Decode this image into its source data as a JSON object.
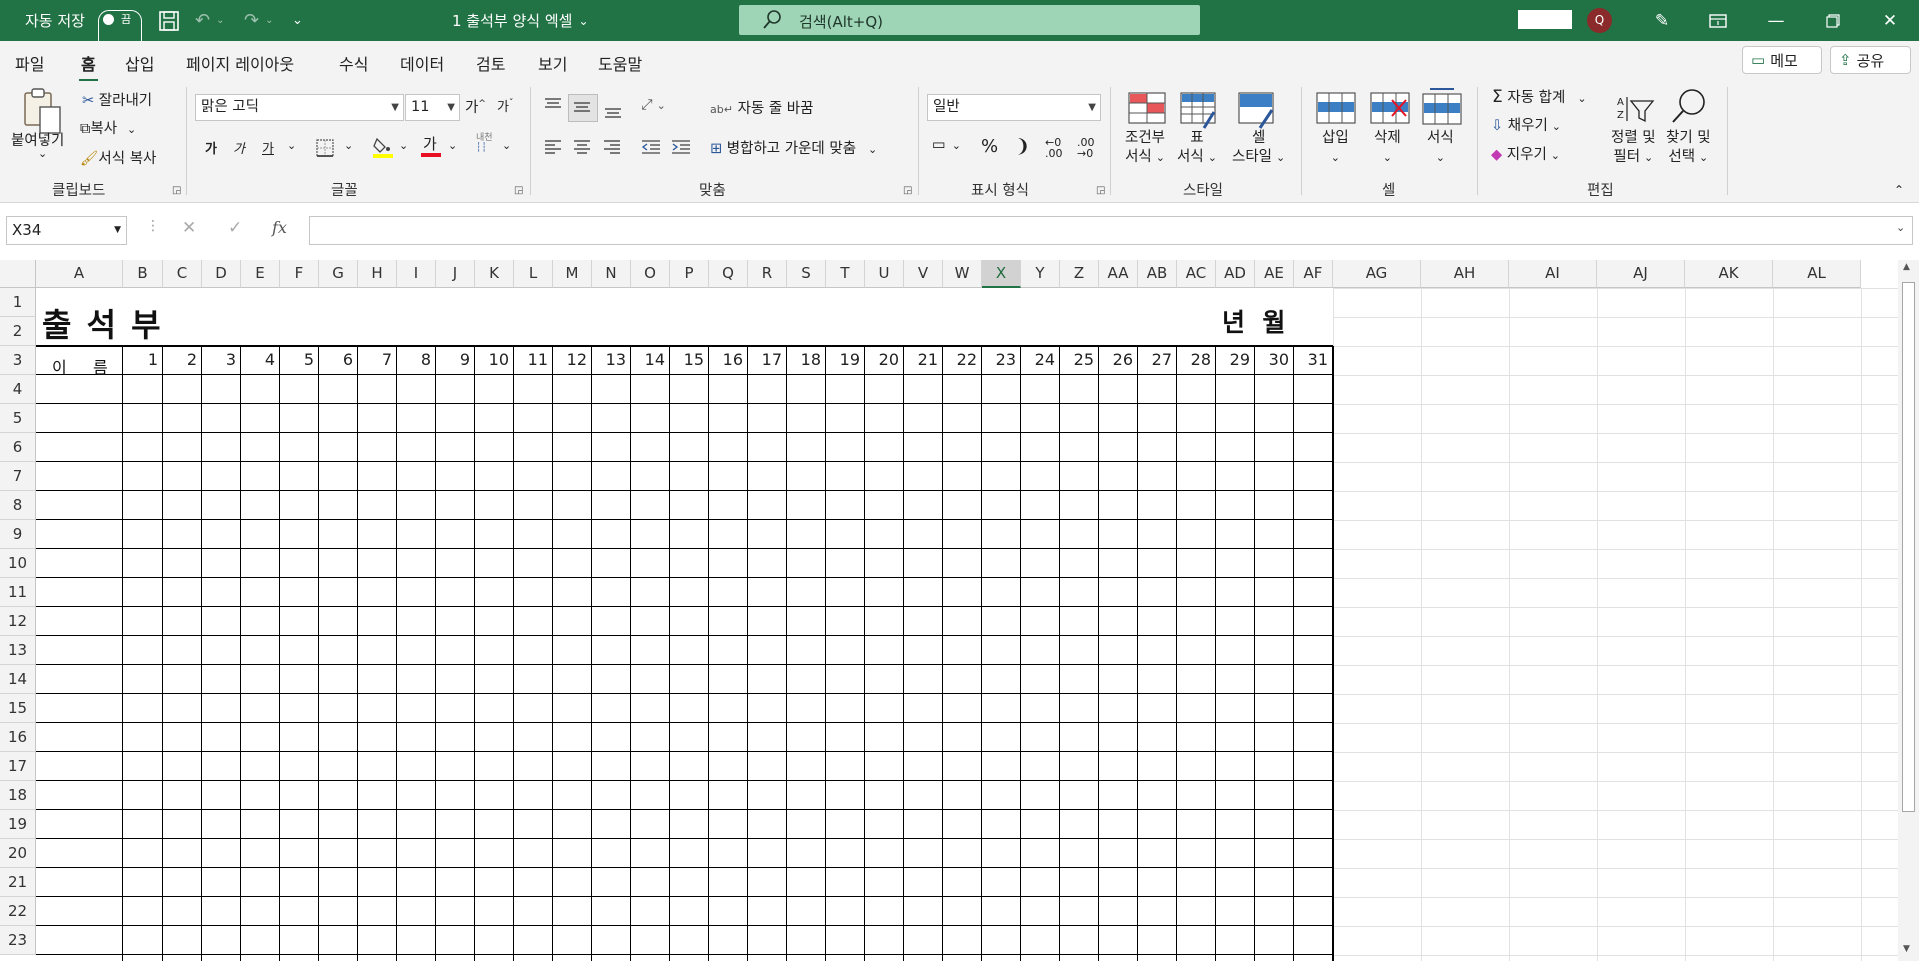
{
  "titlebar": {
    "autosave_label": "자동 저장",
    "autosave_state": "끔",
    "doc_title": "1 출석부 양식 엑셀",
    "search_placeholder": "검색(Alt+Q)",
    "avatar_initial": "Q"
  },
  "menu": {
    "tabs": [
      "파일",
      "홈",
      "삽입",
      "페이지 레이아웃",
      "수식",
      "데이터",
      "검토",
      "보기",
      "도움말"
    ],
    "active": "홈",
    "memo": "메모",
    "share": "공유"
  },
  "ribbon": {
    "clipboard": {
      "paste": "붙여넣기",
      "cut": "잘라내기",
      "copy": "복사",
      "format_painter": "서식 복사",
      "group": "클립보드"
    },
    "font": {
      "name": "맑은 고딕",
      "size": "11",
      "bold": "가",
      "italic": "가",
      "underline": "가",
      "group": "글꼴",
      "increase": "가",
      "decrease": "가",
      "phonetic": "내천"
    },
    "alignment": {
      "wrap": "자동 줄 바꿈",
      "merge": "병합하고 가운데 맞춤",
      "group": "맞춤"
    },
    "number": {
      "format": "일반",
      "group": "표시 형식"
    },
    "styles": {
      "conditional_1": "조건부",
      "conditional_2": "서식",
      "table_1": "표",
      "table_2": "서식",
      "cell_1": "셀",
      "cell_2": "스타일",
      "group": "스타일"
    },
    "cells": {
      "insert": "삽입",
      "delete": "삭제",
      "format": "서식",
      "group": "셀"
    },
    "editing": {
      "autosum": "자동 합계",
      "fill": "채우기",
      "clear": "지우기",
      "sort_1": "정렬 및",
      "sort_2": "필터",
      "find_1": "찾기 및",
      "find_2": "선택",
      "group": "편집"
    }
  },
  "formula_bar": {
    "name_box": "X34",
    "fx": "fx",
    "value": ""
  },
  "sheet": {
    "columns": [
      "A",
      "B",
      "C",
      "D",
      "E",
      "F",
      "G",
      "H",
      "I",
      "J",
      "K",
      "L",
      "M",
      "N",
      "O",
      "P",
      "Q",
      "R",
      "S",
      "T",
      "U",
      "V",
      "W",
      "X",
      "Y",
      "Z",
      "AA",
      "AB",
      "AC",
      "AD",
      "AE",
      "AF",
      "AG",
      "AH",
      "AI",
      "AJ",
      "AK",
      "AL"
    ],
    "selected_column": "X",
    "rows": [
      "1",
      "2",
      "3",
      "4",
      "5",
      "6",
      "7",
      "8",
      "9",
      "10",
      "11",
      "12",
      "13",
      "14",
      "15",
      "16",
      "17",
      "18",
      "19",
      "20",
      "21",
      "22",
      "23"
    ],
    "title": "출 석 부",
    "year_month": "년  월",
    "name_header_1": "이",
    "name_header_2": "름",
    "days": [
      "1",
      "2",
      "3",
      "4",
      "5",
      "6",
      "7",
      "8",
      "9",
      "10",
      "11",
      "12",
      "13",
      "14",
      "15",
      "16",
      "17",
      "18",
      "19",
      "20",
      "21",
      "22",
      "23",
      "24",
      "25",
      "26",
      "27",
      "28",
      "29",
      "30",
      "31"
    ]
  }
}
